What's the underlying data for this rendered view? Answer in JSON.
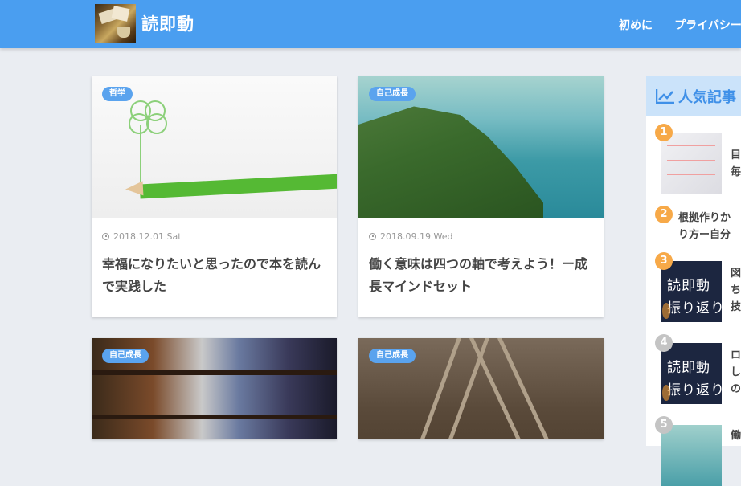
{
  "header": {
    "site_title": "読即動",
    "nav": [
      "初めに",
      "プライバシー"
    ]
  },
  "posts": [
    {
      "category": "哲学",
      "date": "2018.12.01 Sat",
      "title": "幸福になりたいと思ったので本を読んで実践した"
    },
    {
      "category": "自己成長",
      "date": "2018.09.19 Wed",
      "title": "働く意味は四つの軸で考えよう！ー成長マインドセット"
    },
    {
      "category": "自己成長"
    },
    {
      "category": "自己成長"
    }
  ],
  "sidebar": {
    "title": "人気記事",
    "items": [
      {
        "rank": "1",
        "text": "目\n毎"
      },
      {
        "rank": "2",
        "text": "根拠作りか\nり方ー自分"
      },
      {
        "rank": "3",
        "thumb_text": "読即動\n振り返り",
        "text": "図\nち\n技"
      },
      {
        "rank": "4",
        "thumb_text": "読即動\n振り返り",
        "text": "ロ\nし\nの"
      },
      {
        "rank": "5",
        "text": "働"
      }
    ]
  },
  "colors": {
    "header": "#4a9ef0",
    "badge": "#5aa3ee",
    "rank_top": "#f7a948",
    "rank_other": "#c4c4c4"
  }
}
